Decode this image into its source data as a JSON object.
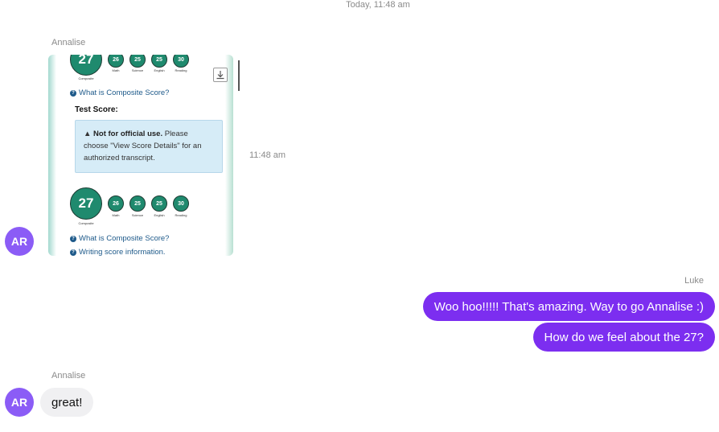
{
  "header": {
    "timestamp": "Today, 11:48 am"
  },
  "messages": [
    {
      "sender": "Annalise",
      "avatar_initials": "AR",
      "time": "11:48 am",
      "attachment": {
        "top_scores": {
          "composite": "27",
          "subs": [
            "26",
            "25",
            "25",
            "30"
          ],
          "composite_label": "Composite",
          "sub_labels": [
            "Math",
            "Science",
            "English",
            "Reading"
          ]
        },
        "composite_link": "What is Composite Score?",
        "test_score_label": "Test Score:",
        "notice_bold": "Not for official use.",
        "notice_text": " Please choose \"View Score Details\" for an authorized transcript.",
        "bottom_scores": {
          "composite": "27",
          "subs": [
            "26",
            "25",
            "25",
            "30"
          ],
          "composite_label": "Composite",
          "sub_labels": [
            "Math",
            "Science",
            "English",
            "Reading"
          ]
        },
        "composite_link_2": "What is Composite Score?",
        "writing_link": "Writing score information."
      }
    },
    {
      "sender": "Luke",
      "bubbles": [
        "Woo hoo!!!!! That's amazing. Way to go Annalise :)",
        "How do we feel about the 27?"
      ]
    },
    {
      "sender": "Annalise",
      "avatar_initials": "AR",
      "bubbles": [
        "great!"
      ]
    }
  ],
  "colors": {
    "outgoing_bubble": "#7c2ef0",
    "avatar": "#8b5cf6",
    "score_circle": "#1f8a6e"
  }
}
